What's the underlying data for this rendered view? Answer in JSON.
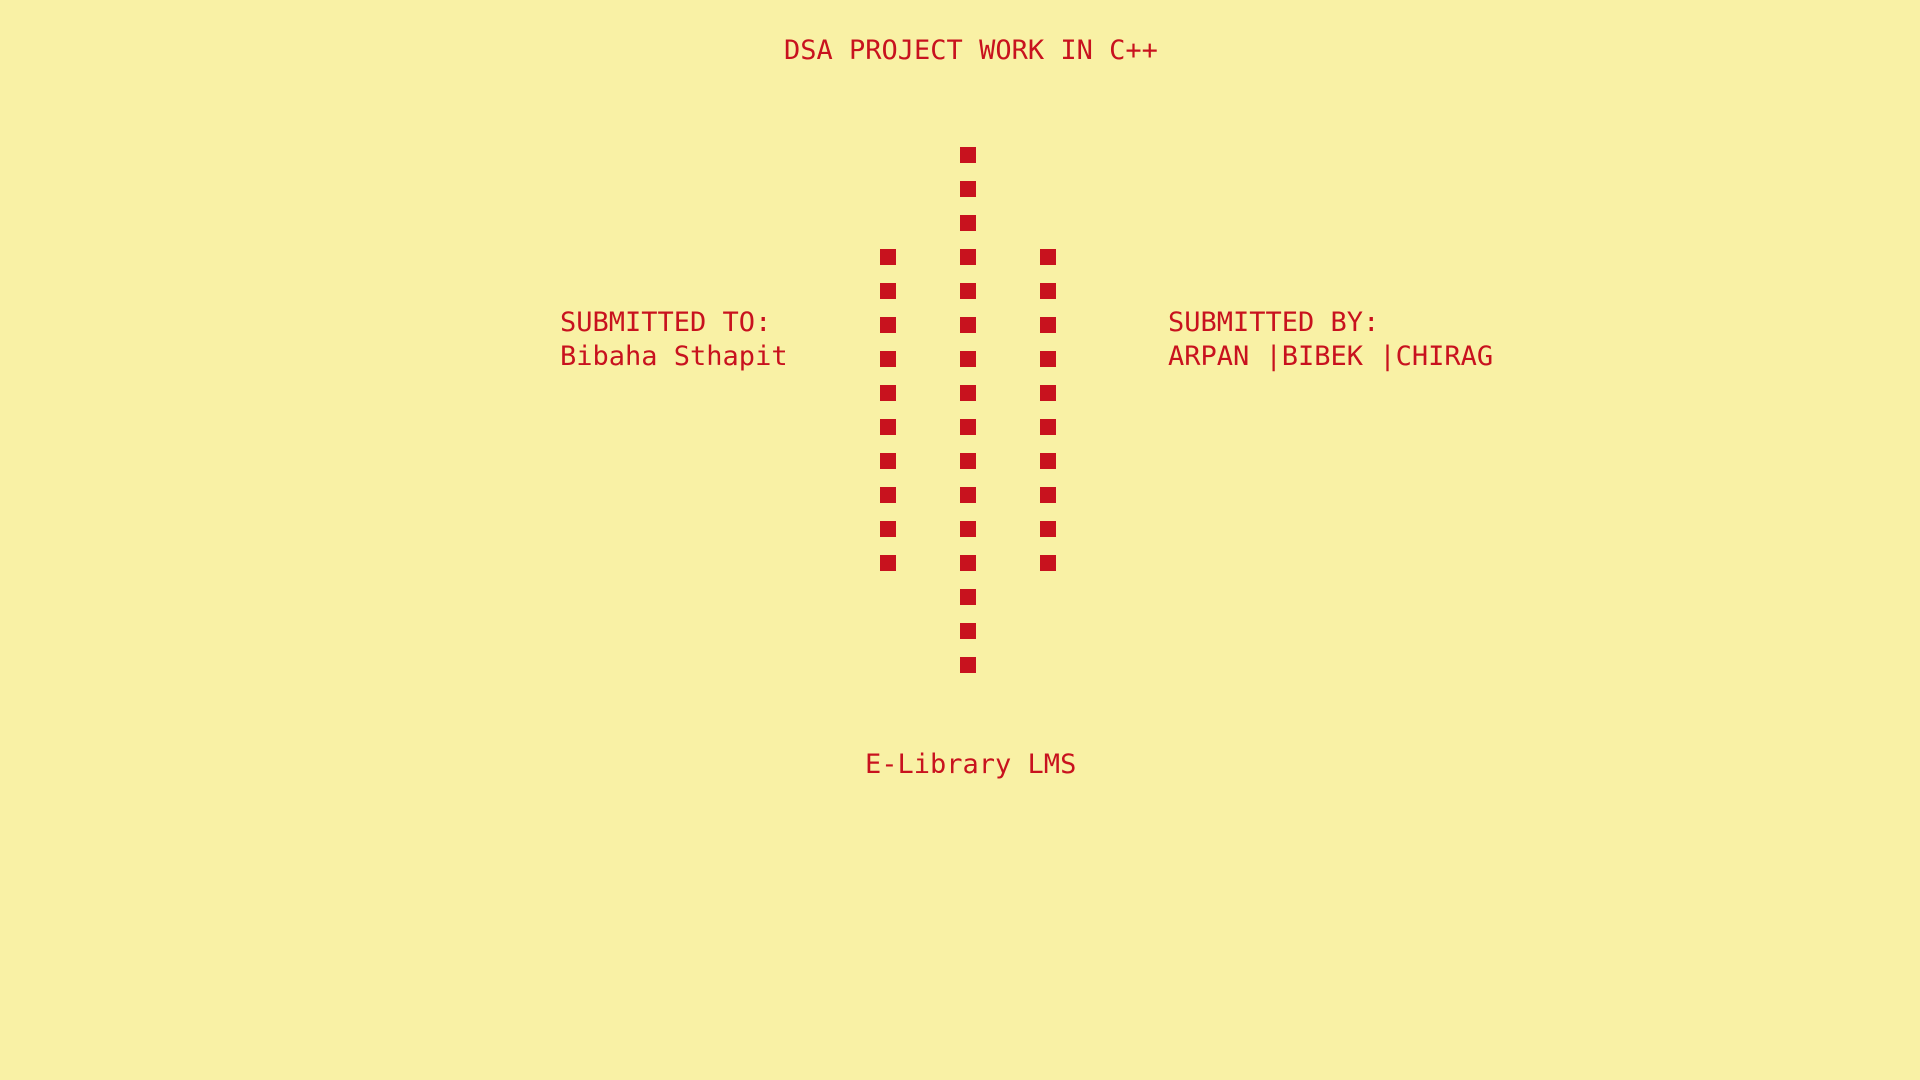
{
  "screen": {
    "title": "DSA PROJECT WORK IN C++",
    "submitted_to_label": "SUBMITTED TO:",
    "submitted_to_name": "Bibaha Sthapit",
    "submitted_by_label": "SUBMITTED BY:",
    "submitted_by_names": "ARPAN |BIBEK |CHIRAG",
    "footer": "E-Library LMS"
  },
  "colors": {
    "background": "#f9f1a5",
    "foreground": "#c8121e"
  },
  "decoration": {
    "icon": "block-square-glyph",
    "columns": [
      {
        "name": "left",
        "count": 10
      },
      {
        "name": "center",
        "count": 16
      },
      {
        "name": "right",
        "count": 10
      }
    ]
  }
}
